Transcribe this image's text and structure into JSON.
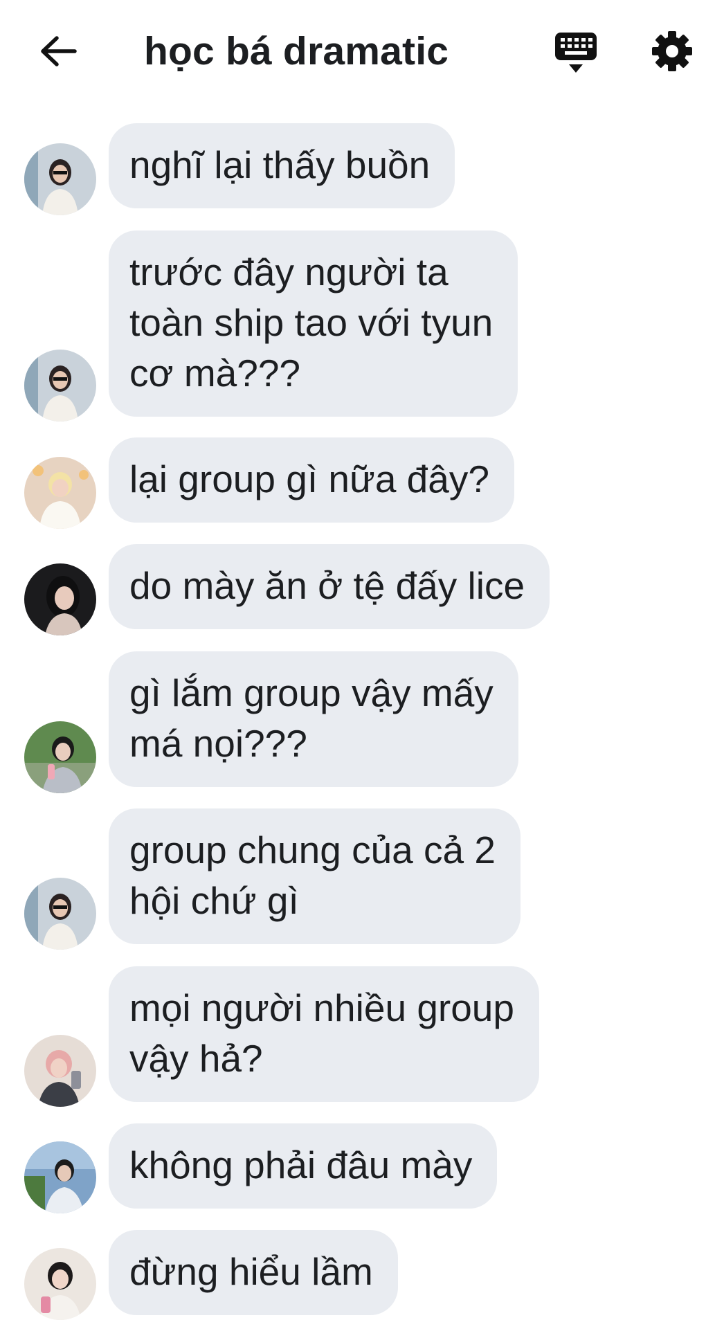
{
  "header": {
    "title": "học bá dramatic",
    "back_icon": "arrow-left-icon",
    "keyboard_icon": "keyboard-icon",
    "settings_icon": "gear-icon"
  },
  "colors": {
    "bubble_bg": "#e9ecf1",
    "text": "#1c1e21",
    "icon": "#111111"
  },
  "messages": [
    {
      "text": "nghĩ lại thấy buồn"
    },
    {
      "text": "trước đây người ta\ntoàn ship tao với tyun\ncơ mà???"
    },
    {
      "text": "lại group gì nữa đây?"
    },
    {
      "text": "do mày ăn ở tệ đấy lice"
    },
    {
      "text": "gì lắm group vậy mấy\nmá nọi???"
    },
    {
      "text": "group chung của cả 2\nhội chứ gì"
    },
    {
      "text": "mọi người nhiều group\nvậy hả?"
    },
    {
      "text": "không phải đâu mày"
    },
    {
      "text": "đừng hiểu lầm"
    }
  ]
}
